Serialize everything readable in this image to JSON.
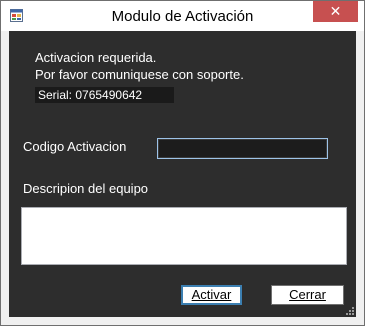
{
  "window": {
    "title": "Modulo de Activación",
    "close_label": "✕"
  },
  "message": {
    "line1": "Activacion requerida.",
    "line2": "Por favor comuniquese con soporte."
  },
  "serial": {
    "text": "Serial: 0765490642"
  },
  "form": {
    "code_label": "Codigo Activacion",
    "code_value": "",
    "description_label": "Descripion del equipo",
    "description_value": ""
  },
  "buttons": {
    "activate": "Activar",
    "close": "Cerrar"
  },
  "colors": {
    "client_background": "#2d2d2d",
    "close_button": "#c75050",
    "focus_border": "#3c7fb1"
  },
  "icons": {
    "app": "application-icon",
    "close": "close-icon",
    "grip": "resize-grip-icon"
  }
}
